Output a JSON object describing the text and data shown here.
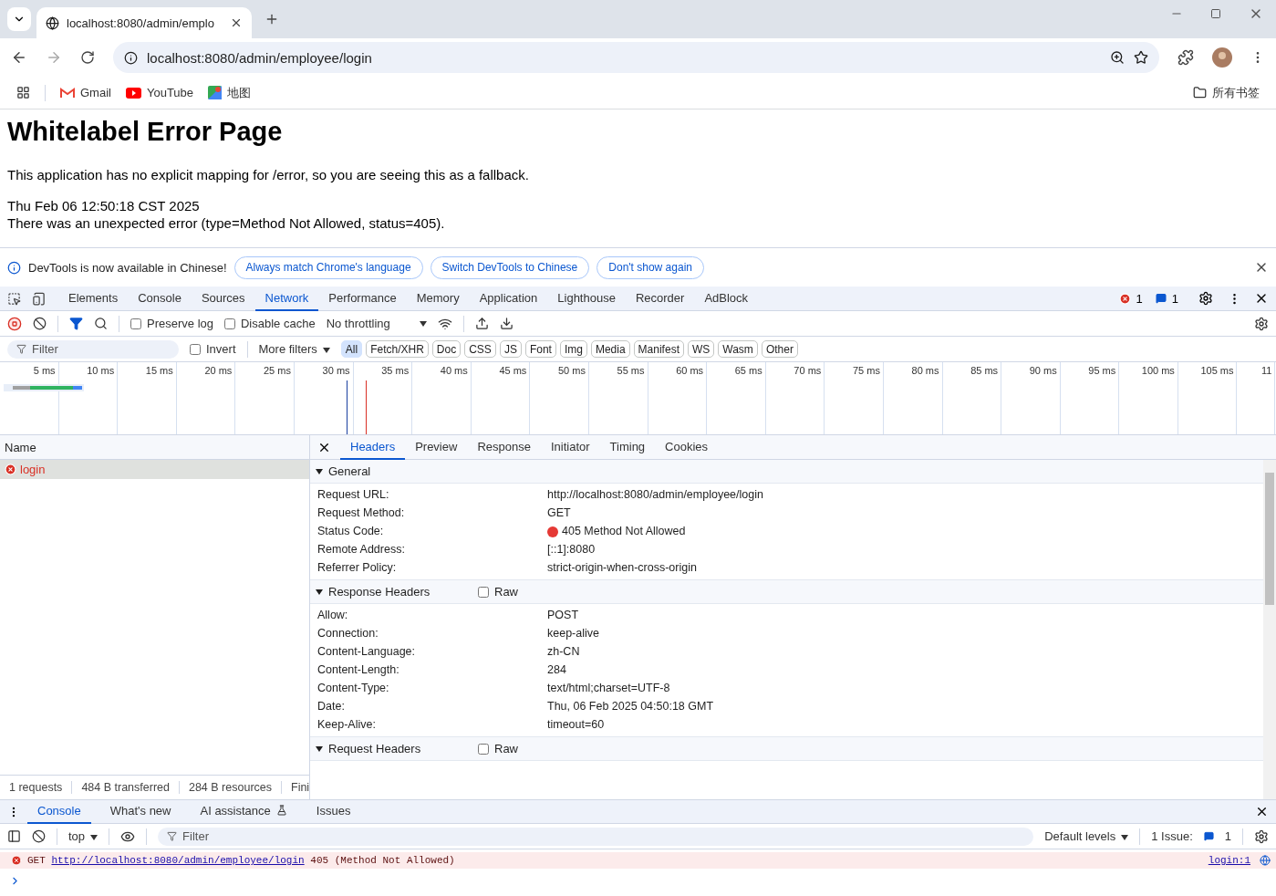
{
  "browser": {
    "tab_title": "localhost:8080/admin/emplo",
    "url": "localhost:8080/admin/employee/login",
    "bookmarks": [
      {
        "label": "Gmail",
        "kind": "gmail"
      },
      {
        "label": "YouTube",
        "kind": "youtube"
      },
      {
        "label": "地图",
        "kind": "maps"
      }
    ],
    "all_bookmarks": "所有书签"
  },
  "page": {
    "title": "Whitelabel Error Page",
    "intro": "This application has no explicit mapping for /error, so you are seeing this as a fallback.",
    "lines": [
      "Thu Feb 06 12:50:18 CST 2025",
      "There was an unexpected error (type=Method Not Allowed, status=405)."
    ]
  },
  "infobar": {
    "message": "DevTools is now available in Chinese!",
    "buttons": [
      "Always match Chrome's language",
      "Switch DevTools to Chinese",
      "Don't show again"
    ]
  },
  "devtools": {
    "tabs": [
      {
        "label": "Elements",
        "selected": false
      },
      {
        "label": "Console",
        "selected": false
      },
      {
        "label": "Sources",
        "selected": false
      },
      {
        "label": "Network",
        "selected": true
      },
      {
        "label": "Performance",
        "selected": false
      },
      {
        "label": "Memory",
        "selected": false
      },
      {
        "label": "Application",
        "selected": false
      },
      {
        "label": "Lighthouse",
        "selected": false
      },
      {
        "label": "Recorder",
        "selected": false
      },
      {
        "label": "AdBlock",
        "selected": false
      }
    ],
    "error_count": "1",
    "message_count": "1"
  },
  "network_toolbar": {
    "recording": true,
    "preserve_log": {
      "label": "Preserve log",
      "checked": false
    },
    "disable_cache": {
      "label": "Disable cache",
      "checked": false
    },
    "throttling": "No throttling"
  },
  "filter_bar": {
    "placeholder": "Filter",
    "invert": {
      "label": "Invert",
      "checked": false
    },
    "more_filters": "More filters",
    "types": [
      {
        "label": "All",
        "selected": true
      },
      {
        "label": "Fetch/XHR",
        "selected": false
      },
      {
        "label": "Doc",
        "selected": false
      },
      {
        "label": "CSS",
        "selected": false
      },
      {
        "label": "JS",
        "selected": false
      },
      {
        "label": "Font",
        "selected": false
      },
      {
        "label": "Img",
        "selected": false
      },
      {
        "label": "Media",
        "selected": false
      },
      {
        "label": "Manifest",
        "selected": false
      },
      {
        "label": "WS",
        "selected": false
      },
      {
        "label": "Wasm",
        "selected": false
      },
      {
        "label": "Other",
        "selected": false
      }
    ]
  },
  "timeline": {
    "ticks": [
      "5 ms",
      "10 ms",
      "15 ms",
      "20 ms",
      "25 ms",
      "30 ms",
      "35 ms",
      "40 ms",
      "45 ms",
      "50 ms",
      "55 ms",
      "60 ms",
      "65 ms",
      "70 ms",
      "75 ms",
      "80 ms",
      "85 ms",
      "90 ms",
      "95 ms",
      "100 ms",
      "105 ms",
      "11"
    ]
  },
  "requests": {
    "column": "Name",
    "rows": [
      {
        "name": "login",
        "failed": true,
        "selected": true
      }
    ]
  },
  "details": {
    "tabs": [
      {
        "label": "Headers",
        "selected": true
      },
      {
        "label": "Preview",
        "selected": false
      },
      {
        "label": "Response",
        "selected": false
      },
      {
        "label": "Initiator",
        "selected": false
      },
      {
        "label": "Timing",
        "selected": false
      },
      {
        "label": "Cookies",
        "selected": false
      }
    ],
    "sections": [
      {
        "title": "General",
        "expanded": true,
        "rows": [
          {
            "key": "Request URL:",
            "value": "http://localhost:8080/admin/employee/login"
          },
          {
            "key": "Request Method:",
            "value": "GET"
          },
          {
            "key": "Status Code:",
            "value": "405 Method Not Allowed",
            "color": "#e53935"
          },
          {
            "key": "Remote Address:",
            "value": "[::1]:8080"
          },
          {
            "key": "Referrer Policy:",
            "value": "strict-origin-when-cross-origin"
          }
        ]
      },
      {
        "title": "Response Headers",
        "expanded": true,
        "raw": {
          "label": "Raw",
          "checked": false
        },
        "rows": [
          {
            "key": "Allow:",
            "value": "POST"
          },
          {
            "key": "Connection:",
            "value": "keep-alive"
          },
          {
            "key": "Content-Language:",
            "value": "zh-CN"
          },
          {
            "key": "Content-Length:",
            "value": "284"
          },
          {
            "key": "Content-Type:",
            "value": "text/html;charset=UTF-8"
          },
          {
            "key": "Date:",
            "value": "Thu, 06 Feb 2025 04:50:18 GMT"
          },
          {
            "key": "Keep-Alive:",
            "value": "timeout=60"
          }
        ]
      },
      {
        "title": "Request Headers",
        "expanded": true,
        "raw": {
          "label": "Raw",
          "checked": false
        }
      }
    ]
  },
  "status_bar": [
    "1 requests",
    "484 B transferred",
    "284 B resources",
    "Fini"
  ],
  "drawer": {
    "tabs": [
      {
        "label": "Console",
        "selected": true
      },
      {
        "label": "What's new",
        "selected": false
      },
      {
        "label": "AI assistance",
        "selected": false,
        "kind": "ai"
      },
      {
        "label": "Issues",
        "selected": false
      }
    ],
    "context": "top",
    "filter_placeholder": "Filter",
    "levels": "Default levels",
    "issues_label": "1 Issue:",
    "issues_count": "1"
  },
  "console": [
    {
      "kind": "error",
      "method": "GET",
      "url": "http://localhost:8080/admin/employee/login",
      "text": "405 (Method Not Allowed)",
      "source": "login:1"
    }
  ]
}
